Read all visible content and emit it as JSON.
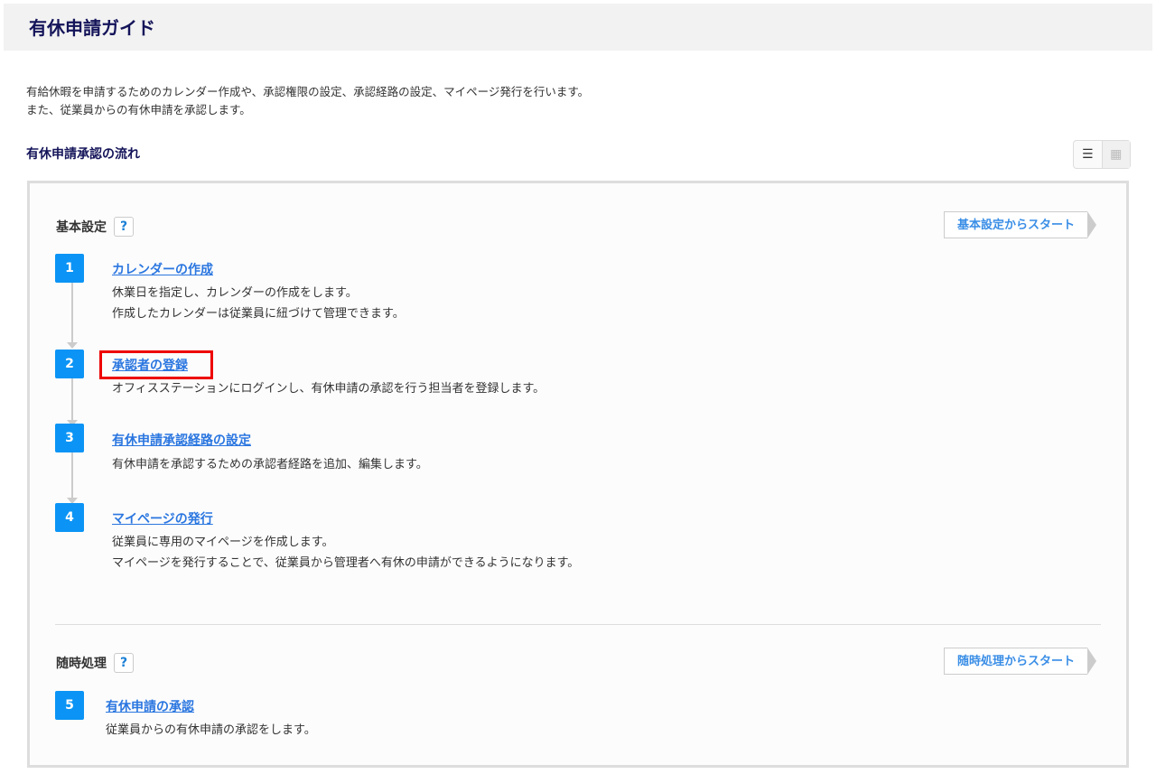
{
  "header": {
    "title": "有休申請ガイド"
  },
  "intro": [
    "有給休暇を申請するためのカレンダー作成や、承認権限の設定、承認経路の設定、マイページ発行を行います。",
    "また、従業員からの有休申請を承認します。"
  ],
  "flow_title": "有休申請承認の流れ",
  "view_toggle": {
    "list_icon": "☰",
    "grid_icon": "▦"
  },
  "basic": {
    "label": "基本設定",
    "help": "?",
    "start": "基本設定からスタート",
    "steps": [
      {
        "num": "1",
        "title": "カレンダーの作成",
        "desc": [
          "休業日を指定し、カレンダーの作成をします。",
          "作成したカレンダーは従業員に紐づけて管理できます。"
        ]
      },
      {
        "num": "2",
        "title": "承認者の登録",
        "desc": [
          "オフィスステーションにログインし、有休申請の承認を行う担当者を登録します。"
        ]
      },
      {
        "num": "3",
        "title": "有休申請承認経路の設定",
        "desc": [
          "有休申請を承認するための承認者経路を追加、編集します。"
        ]
      },
      {
        "num": "4",
        "title": "マイページの発行",
        "desc": [
          "従業員に専用のマイページを作成します。",
          "マイページを発行することで、従業員から管理者へ有休の申請ができるようになります。"
        ]
      }
    ]
  },
  "adhoc": {
    "label": "随時処理",
    "help": "?",
    "start": "随時処理からスタート",
    "steps": [
      {
        "num": "5",
        "title": "有休申請の承認",
        "desc": [
          "従業員からの有休申請の承認をします。"
        ]
      }
    ]
  }
}
